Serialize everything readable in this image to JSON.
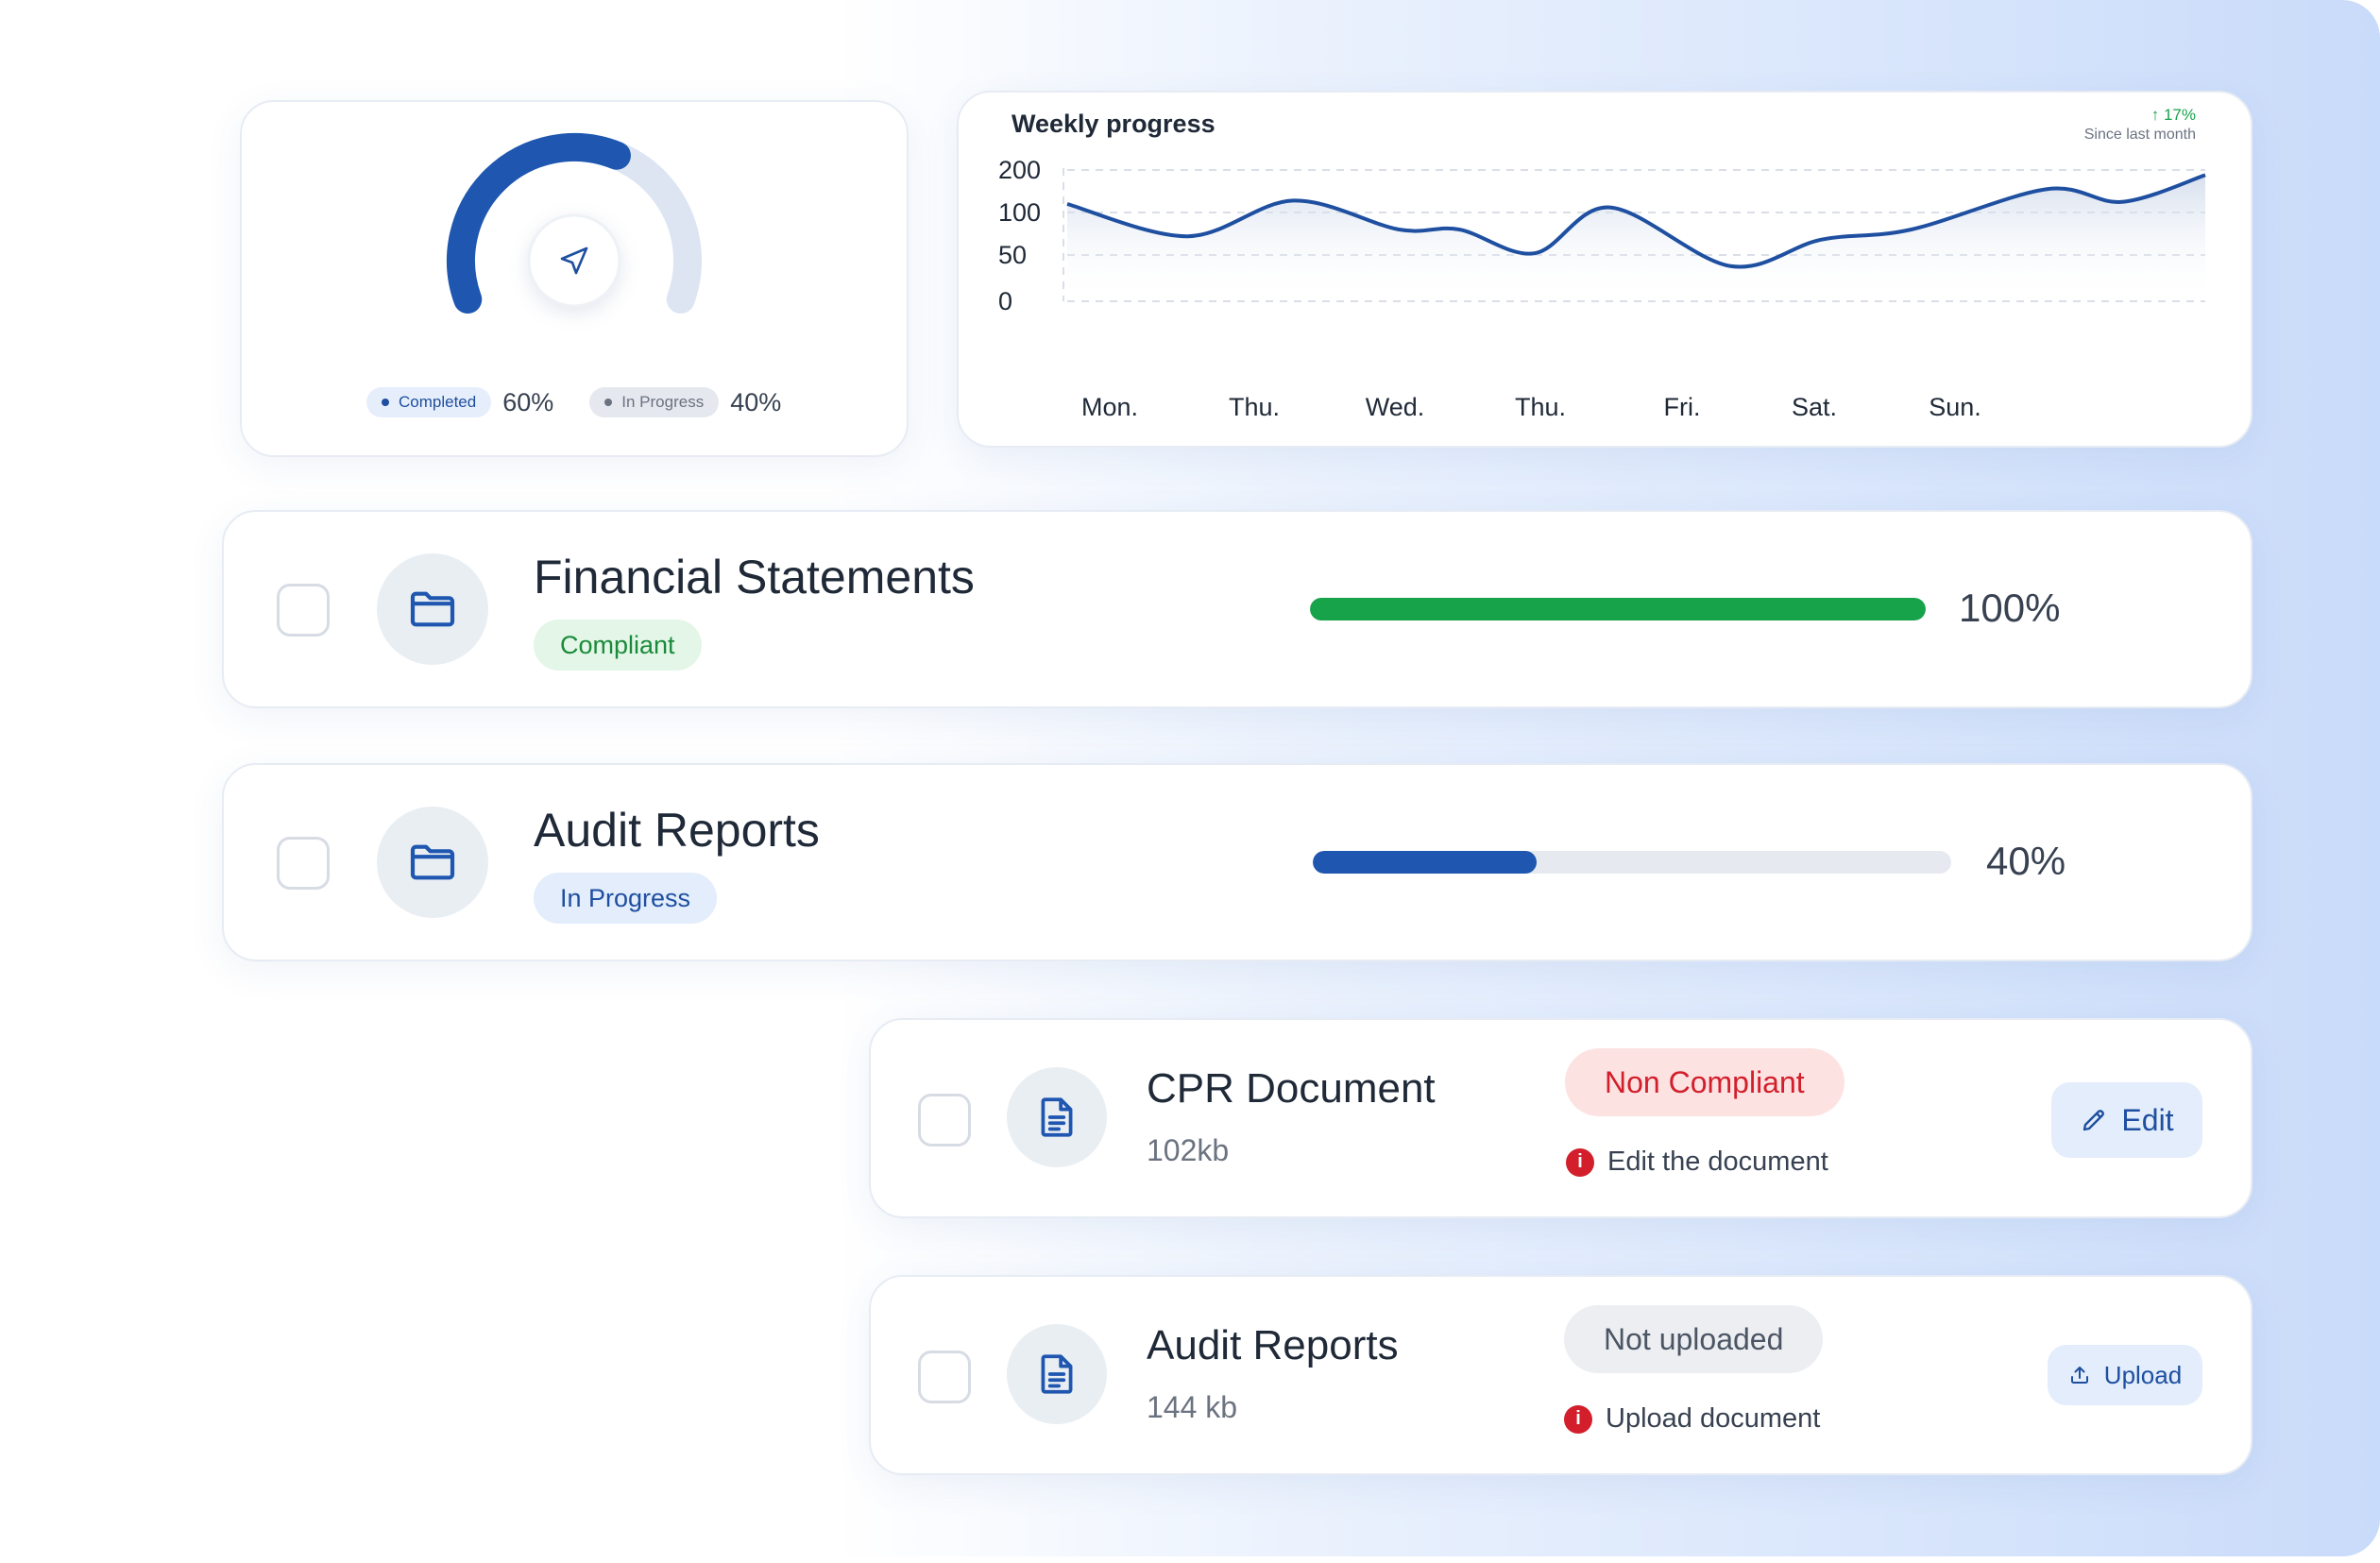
{
  "gauge": {
    "completed_label": "Completed",
    "completed_pct": "60%",
    "in_progress_label": "In Progress",
    "in_progress_pct": "40%",
    "completed_fraction": 0.6,
    "colors": {
      "completed": "#1e56b0",
      "remaining": "#dde5f2"
    },
    "center_icon": "navigation-arrow-icon"
  },
  "weekly": {
    "title": "Weekly progress",
    "trend_value": "17%",
    "trend_caption": "Since last month",
    "trend_icon": "arrow-up-icon"
  },
  "chart_data": {
    "type": "area",
    "title": "Weekly progress",
    "x_tick_labels": [
      "Mon.",
      "Thu.",
      "Wed.",
      "Thu.",
      "Fri.",
      "Sat.",
      "Sun."
    ],
    "y_tick_labels": [
      "200",
      "100",
      "50",
      "0"
    ],
    "y_ticks": [
      200,
      100,
      50,
      0
    ],
    "ylim": [
      0,
      200
    ],
    "grid": true,
    "line_color": "#1e4fa0",
    "points": [
      {
        "x": 0.0,
        "y": 120
      },
      {
        "x": 0.8,
        "y": 72
      },
      {
        "x": 1.5,
        "y": 128
      },
      {
        "x": 2.2,
        "y": 80
      },
      {
        "x": 2.6,
        "y": 80
      },
      {
        "x": 3.1,
        "y": 52
      },
      {
        "x": 3.6,
        "y": 112
      },
      {
        "x": 4.4,
        "y": 38
      },
      {
        "x": 5.0,
        "y": 68
      },
      {
        "x": 5.6,
        "y": 80
      },
      {
        "x": 6.5,
        "y": 155
      },
      {
        "x": 7.0,
        "y": 125
      },
      {
        "x": 7.55,
        "y": 188
      }
    ]
  },
  "folders": [
    {
      "title": "Financial Statements",
      "status": "Compliant",
      "progress_label": "100%",
      "progress": 1.0,
      "bar_color": "#16a34a",
      "icon": "folder-icon"
    },
    {
      "title": "Audit Reports",
      "status": "In Progress",
      "progress_label": "40%",
      "progress": 0.35,
      "bar_color": "#1e56b0",
      "icon": "folder-icon"
    }
  ],
  "documents": [
    {
      "title": "CPR Document",
      "size": "102kb",
      "status": "Non Compliant",
      "note": "Edit the document",
      "action": "Edit",
      "action_icon": "pencil-icon",
      "icon": "document-icon"
    },
    {
      "title": "Audit Reports",
      "size": "144 kb",
      "status": "Not uploaded",
      "note": "Upload document",
      "action": "Upload",
      "action_icon": "upload-icon",
      "icon": "document-icon"
    }
  ]
}
